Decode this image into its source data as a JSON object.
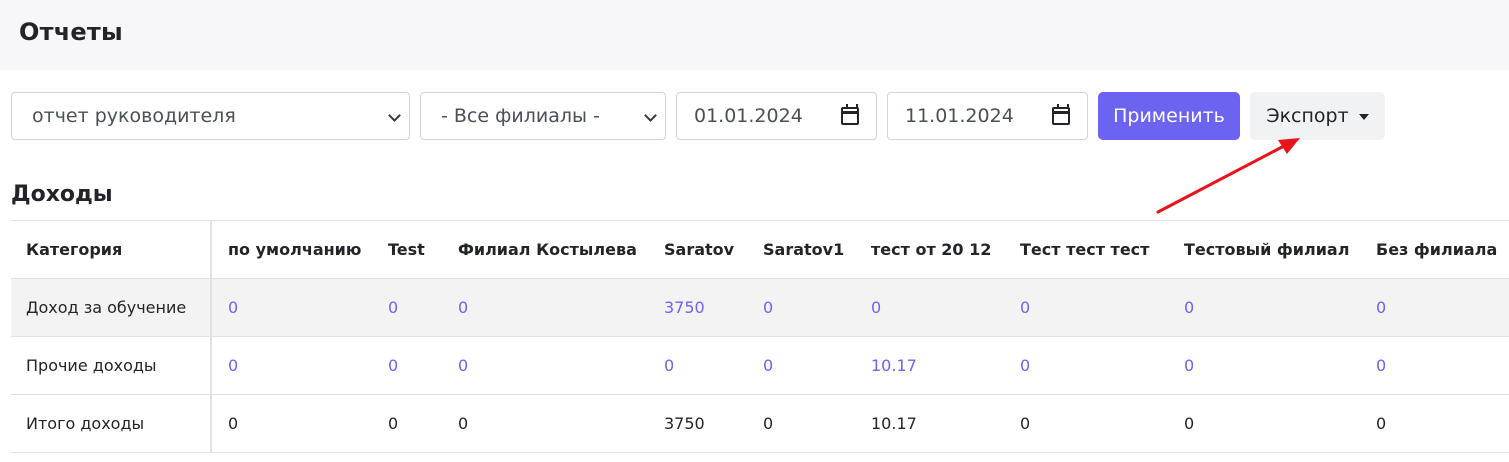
{
  "header": {
    "title": "Отчеты"
  },
  "filters": {
    "report_type": "отчет руководителя",
    "branch": "- Все филиалы -",
    "date_from": "01.01.2024",
    "date_to": "11.01.2024",
    "apply_label": "Применить",
    "export_label": "Экспорт"
  },
  "section": {
    "title": "Доходы"
  },
  "table": {
    "columns": [
      "Категория",
      "по умолчанию",
      "Test",
      "Филиал Костылева",
      "Saratov",
      "Saratov1",
      "тест от 20 12",
      "Тест тест тест",
      "Тестовый филиал",
      "Без филиала"
    ],
    "rows": [
      {
        "label": "Доход за обучение",
        "values": [
          "0",
          "0",
          "0",
          "3750",
          "0",
          "0",
          "0",
          "0",
          "0"
        ]
      },
      {
        "label": "Прочие доходы",
        "values": [
          "0",
          "0",
          "0",
          "0",
          "0",
          "10.17",
          "0",
          "0",
          "0"
        ]
      },
      {
        "label": "Итого доходы",
        "values": [
          "0",
          "0",
          "0",
          "3750",
          "0",
          "10.17",
          "0",
          "0",
          "0"
        ]
      }
    ]
  },
  "colors": {
    "accent": "#6c63f0",
    "annotation_arrow": "#e8141b"
  }
}
